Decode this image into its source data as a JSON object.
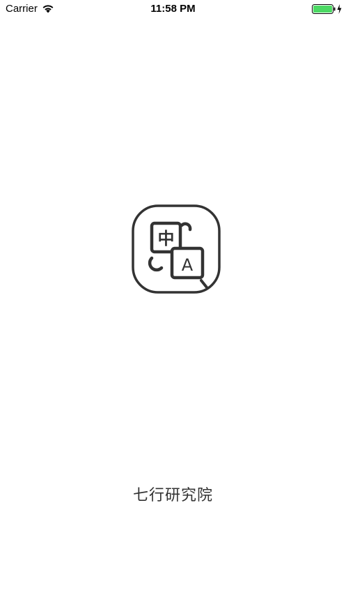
{
  "status_bar": {
    "carrier": "Carrier",
    "time": "11:58 PM",
    "wifi_icon": "wifi-icon",
    "battery_icon": "battery-charging-icon",
    "battery_level": 1.0,
    "battery_color": "#4cd964"
  },
  "logo": {
    "icon": "translate-icon",
    "glyph_cn": "中",
    "glyph_en": "A"
  },
  "brand": {
    "name": "七行研究院"
  }
}
